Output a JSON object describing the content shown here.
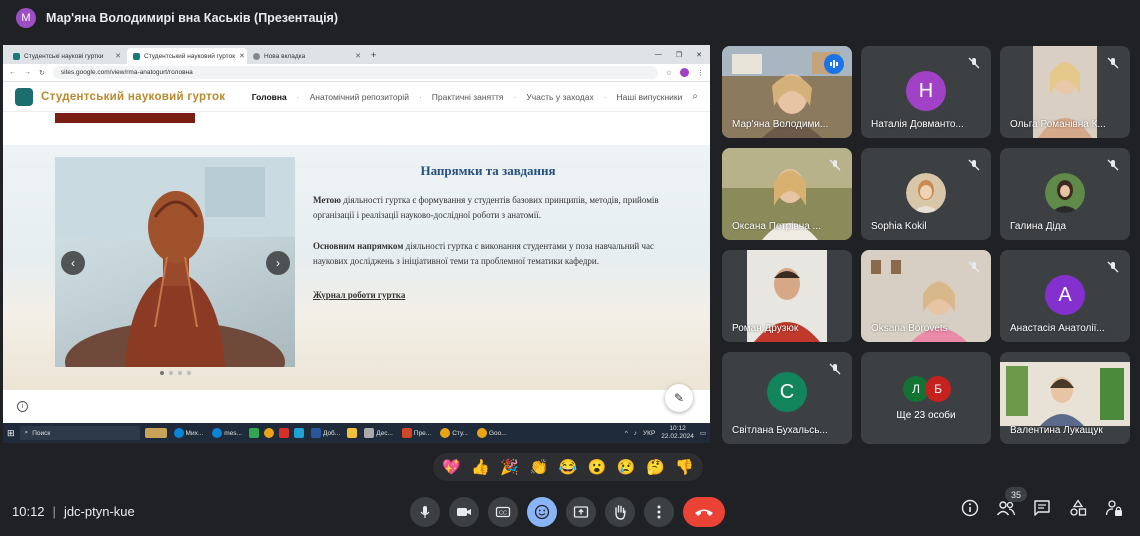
{
  "presentation": {
    "presenter_initial": "M",
    "title": "Мар'яна Володимирі вна Каськів (Презентація)"
  },
  "browser": {
    "tabs": [
      {
        "label": "Студентські наукові гуртки"
      },
      {
        "label": "Студентський науковий гурток"
      },
      {
        "label": "Нова вкладка"
      }
    ],
    "url": "sites.google.com/view/rma-anatogurt/головна"
  },
  "site": {
    "title": "Студентський науковий гурток",
    "nav": [
      "Головна",
      "Анатомічний репозиторій",
      "Практичні заняття",
      "Участь у заходах",
      "Наші випускники"
    ]
  },
  "slide": {
    "heading": "Напрямки та завдання",
    "p1_bold": "Метою",
    "p1_rest": " діяльності гуртка є формування у студентів базових принципів, методів, прийомів організації і реалізації науково-дослідної роботи з анатомії.",
    "p2_bold": "Основним напрямком",
    "p2_rest": " діяльності гуртка є виконання студентами у поза навчальний час наукових досліджень з ініціативної теми та проблемної тематики кафедри.",
    "link": "Журнал роботи гуртка",
    "active_slide": 1,
    "slide_count": 4
  },
  "taskbar": {
    "search": "Поиск",
    "apps": [
      "Мих...",
      "mes...",
      "Доб...",
      "Дес...",
      "Пре...",
      "Сту...",
      "Goo..."
    ],
    "lang": "УКР",
    "time": "10:12",
    "date": "22.02.2024"
  },
  "participants": [
    {
      "name": "Мар'яна Володими...",
      "speaking": true
    },
    {
      "name": "Наталія Довманто...",
      "initial": "Н",
      "color": "#a142c6"
    },
    {
      "name": "Ольга Романівна К..."
    },
    {
      "name": "Оксана Петрівна ..."
    },
    {
      "name": "Sophia Kokil"
    },
    {
      "name": "Галина Діда"
    },
    {
      "name": "Роман Друзюк"
    },
    {
      "name": "Oksana Borovets"
    },
    {
      "name": "Анастасія Анатолії...",
      "initial": "А",
      "color": "#8430ce"
    },
    {
      "name": "Світлана Бухальсь...",
      "initial": "С",
      "color": "#12855c"
    },
    {
      "name": "Валентина Лукащук"
    }
  ],
  "more": {
    "initials": [
      "Л",
      "Б"
    ],
    "colors": [
      "#137333",
      "#c5221f"
    ],
    "label": "Ще 23 особи"
  },
  "reactions": [
    "💖",
    "👍",
    "🎉",
    "👏",
    "😂",
    "😮",
    "😢",
    "🤔",
    "👎"
  ],
  "meeting": {
    "time": "10:12",
    "code": "jdc-ptyn-kue",
    "participant_count": "35"
  }
}
